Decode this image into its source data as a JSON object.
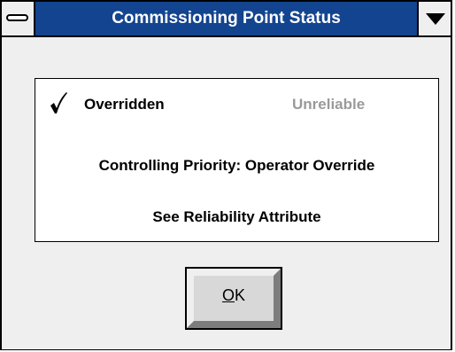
{
  "window": {
    "title": "Commissioning Point Status"
  },
  "status": {
    "overridden_label": "Overridden",
    "overridden_checked": true,
    "unreliable_label": "Unreliable",
    "unreliable_checked": false,
    "priority_text": "Controlling Priority: Operator Override",
    "reliability_text": "See Reliability Attribute"
  },
  "buttons": {
    "ok_mnemonic": "O",
    "ok_rest": "K"
  },
  "icons": {
    "system_menu": "system-menu-icon",
    "dropdown": "chevron-down-icon",
    "check": "checkmark-icon"
  },
  "colors": {
    "titlebar": "#13448f",
    "window_bg": "#efefef",
    "disabled_text": "#9a9a9a"
  }
}
